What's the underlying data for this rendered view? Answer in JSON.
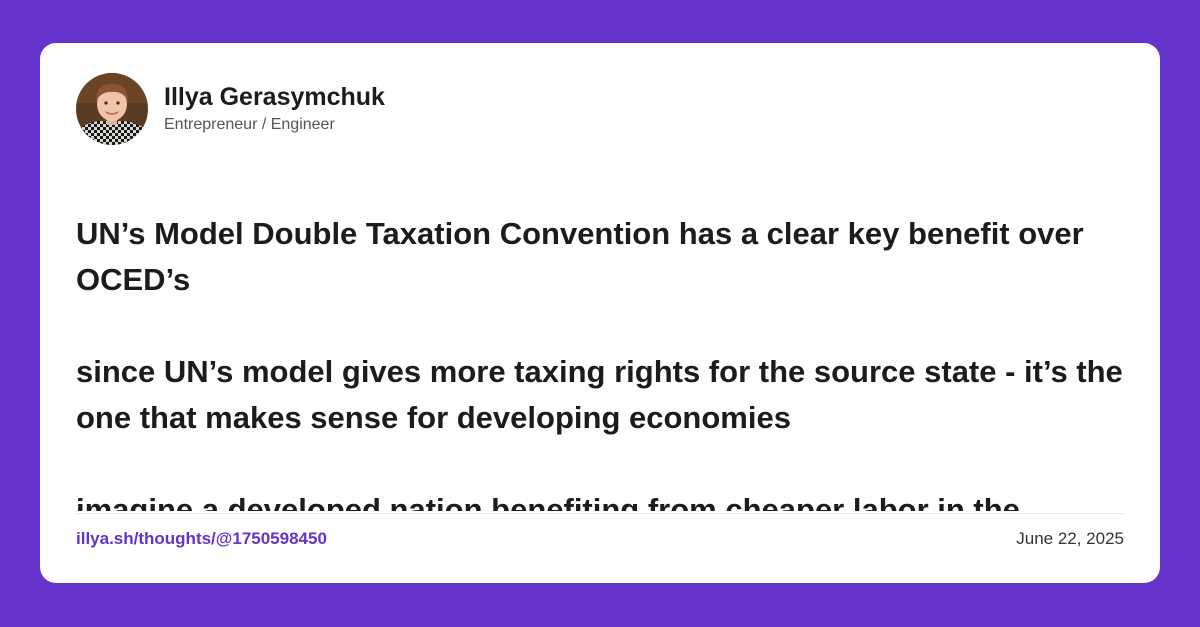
{
  "colors": {
    "background": "#6633cc",
    "card": "#ffffff",
    "link": "#6633cc",
    "text": "#1c1c1c"
  },
  "author": {
    "name": "Illya Gerasymchuk",
    "role": "Entrepreneur / Engineer",
    "avatar_icon": "profile-photo"
  },
  "post": {
    "paragraphs": [
      "UN’s Model Double Taxation Convention has a clear key benefit over OCED’s",
      "since UN’s model gives more taxing rights for the source state - it’s the one that makes sense for developing economies",
      "imagine a developed nation benefiting from cheaper labor in the"
    ]
  },
  "footer": {
    "link": "illya.sh/thoughts/@1750598450",
    "date": "June 22, 2025"
  }
}
